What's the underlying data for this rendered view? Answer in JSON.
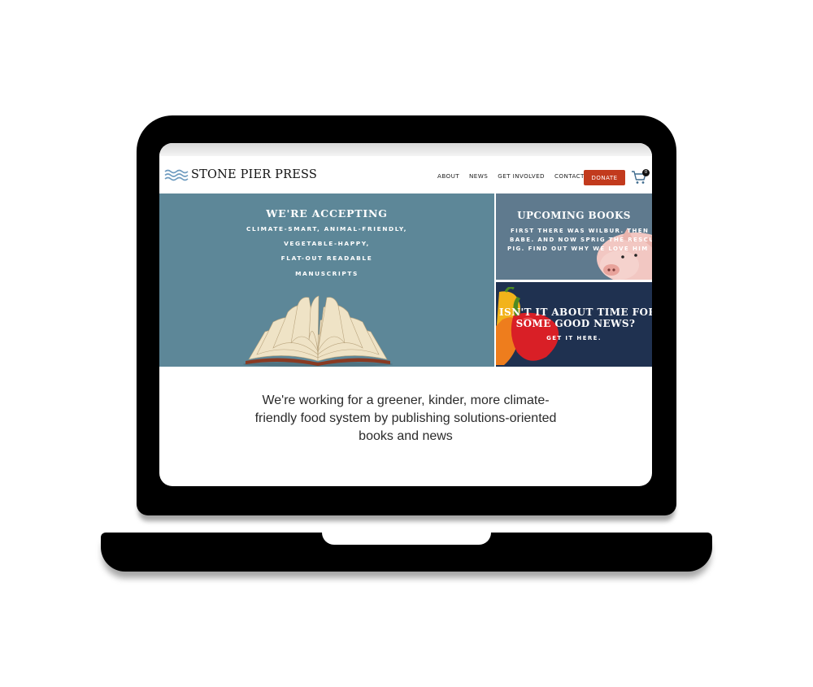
{
  "site": {
    "logo_text": "STONE PIER PRESS",
    "nav": [
      {
        "label": "ABOUT"
      },
      {
        "label": "NEWS"
      },
      {
        "label": "GET INVOLVED"
      },
      {
        "label": "CONTACT"
      }
    ],
    "donate_label": "DONATE",
    "cart_count": "0"
  },
  "hero": {
    "title": "WE'RE ACCEPTING",
    "lines": [
      "CLIMATE-SMART, ANIMAL-FRIENDLY,",
      "VEGETABLE-HAPPY,",
      "FLAT-OUT READABLE",
      "MANUSCRIPTS"
    ]
  },
  "tiles": {
    "books": {
      "title": "UPCOMING BOOKS",
      "lines": [
        "FIRST THERE WAS WILBUR. THEN",
        "BABE. AND NOW SPRIG THE RESCU",
        "PIG. FIND OUT WHY WE LOVE HIM"
      ]
    },
    "news": {
      "title_lines": [
        "ISN'T IT ABOUT TIME FOR",
        "SOME GOOD NEWS?"
      ],
      "cta": "GET IT HERE."
    }
  },
  "mission": {
    "lines": [
      "We're working for a greener, kinder, more climate-",
      "friendly food system by publishing solutions-oriented",
      "books and news"
    ]
  },
  "colors": {
    "hero_bg": "#5d8798",
    "books_tile_bg": "#5f7a8e",
    "news_tile_bg": "#1f3150",
    "donate_bg": "#c23a1d",
    "logo_waves": "#6e9bbf"
  },
  "icons": {
    "logo": "waves-icon",
    "cart": "shopping-cart-icon"
  }
}
